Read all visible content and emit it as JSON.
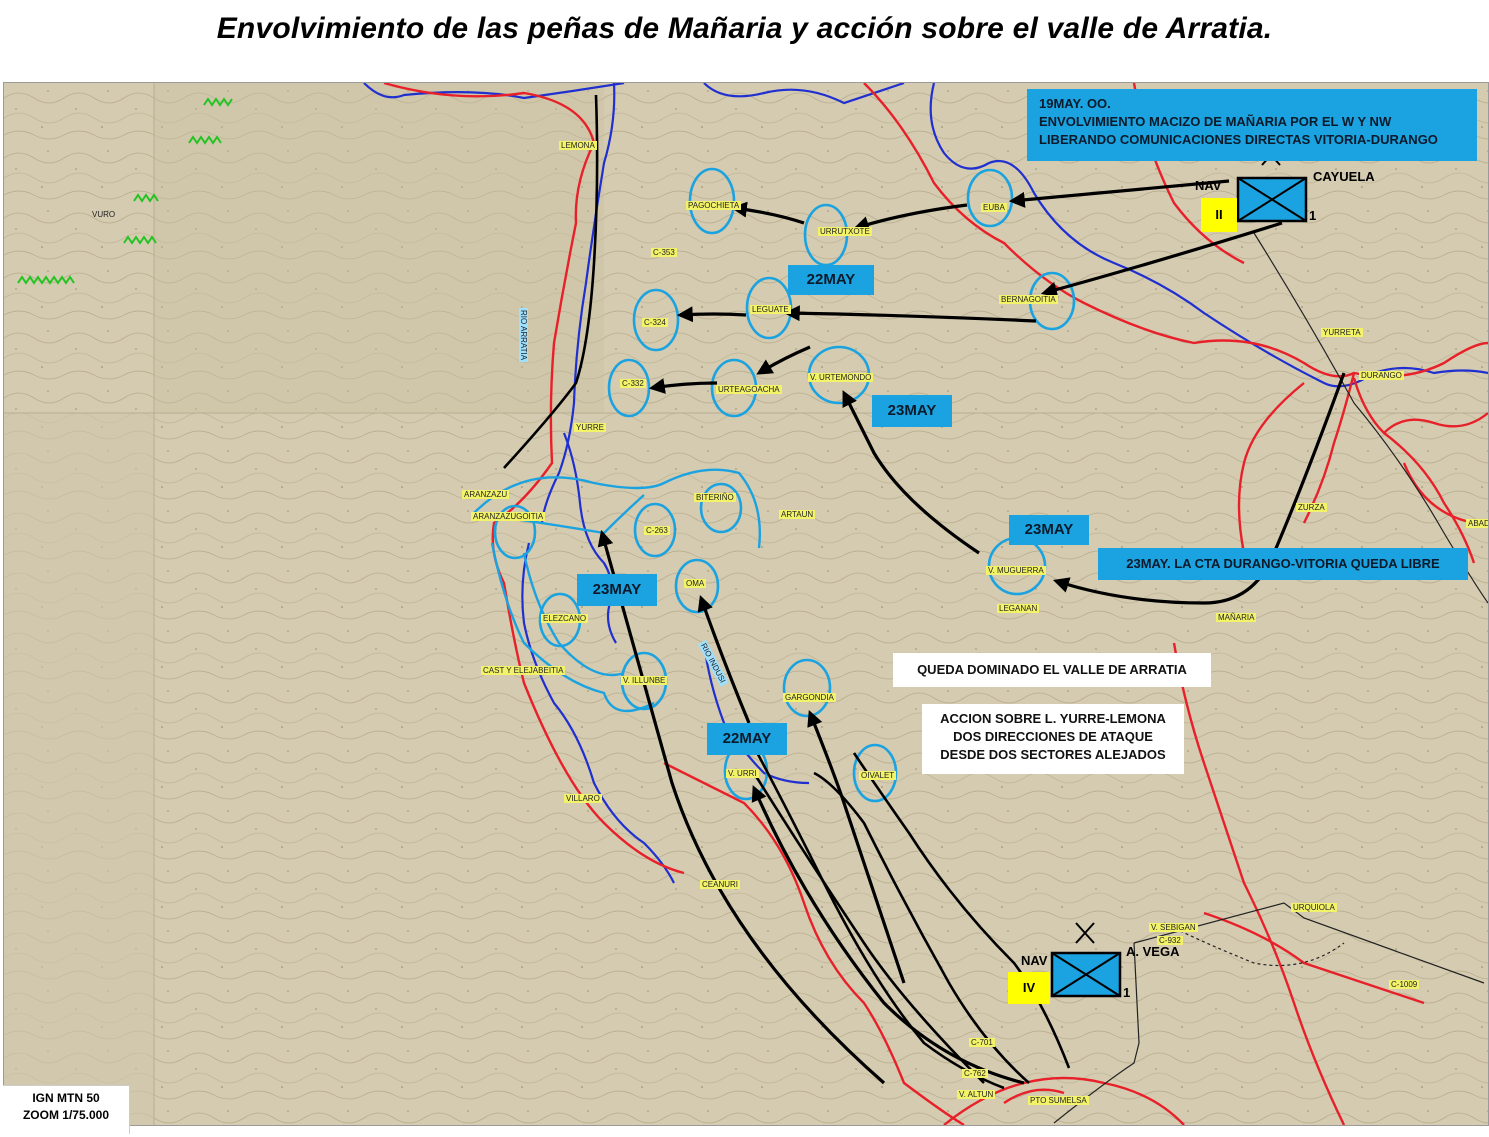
{
  "title": "Envolvimiento de las peñas de Mañaria y acción sobre el valle de Arratia.",
  "info_box": {
    "line1": "19MAY. OO.",
    "line2": "ENVOLVIMIENTO MACIZO DE MAÑARIA POR EL W Y NW",
    "line3": "LIBERANDO COMUNICACIONES DIRECTAS VITORIA-DURANGO"
  },
  "date_tags": {
    "may22_top": "22MAY",
    "may23_center": "23MAY",
    "may23_right": "23MAY",
    "may23_left": "23MAY",
    "may22_bottom": "22MAY"
  },
  "cta_box": "23MAY. LA CTA DURANGO-VITORIA QUEDA LIBRE",
  "valle_box": "QUEDA DOMINADO EL VALLE DE ARRATIA",
  "accion_box": {
    "line1": "ACCION SOBRE L. YURRE-LEMONA",
    "line2": "DOS DIRECCIONES DE ATAQUE",
    "line3": "DESDE DOS SECTORES ALEJADOS"
  },
  "unit_top": {
    "nav": "NAV",
    "number": "II",
    "name": "CAYUELA",
    "size": "1"
  },
  "unit_bottom": {
    "nav": "NAV",
    "number": "IV",
    "name": "A. VEGA",
    "size": "1"
  },
  "places": [
    "LEMONA",
    "PAGOCHIETA",
    "URRUTXOTE",
    "EUBA",
    "C-353",
    "C-324",
    "LEGUATE",
    "BERNAGOITIA",
    "YURRETA",
    "DURANGO",
    "C-332",
    "URTEAGOACHA",
    "V. URTEMONDO",
    "YURRE",
    "ARANZAZU",
    "ARANZAZUGOITIA",
    "BITERIÑO",
    "ARTAUN",
    "C-263",
    "ZURZA",
    "ABAD",
    "V. MUGUERRA",
    "LEGANAN",
    "MAÑARIA",
    "OMA",
    "ELEZCANO",
    "CAST Y ELEJABEITIA",
    "V. ILLUNBE",
    "GARGONDIA",
    "V. URRI",
    "OIVALET",
    "VILLARO",
    "CEANURI",
    "URQUIOLA",
    "V. SEBIGAN",
    "C-932",
    "C-1009",
    "C-701",
    "C-762",
    "V. ALTUN",
    "PTO SUMELSA",
    "VURO"
  ],
  "road_labels": {
    "arratia": "RIO ARRATIA",
    "ibio": "RIO INDUSI"
  },
  "ign_note": {
    "line1": "IGN MTN 50",
    "line2": "ZOOM 1/75.000"
  },
  "colors": {
    "unit_blue": "#1aa3e0",
    "road_red": "#e8202a",
    "river_blue": "#1f2fd0",
    "highlight_yellow": "#ffff00",
    "front_green": "#22c422"
  }
}
